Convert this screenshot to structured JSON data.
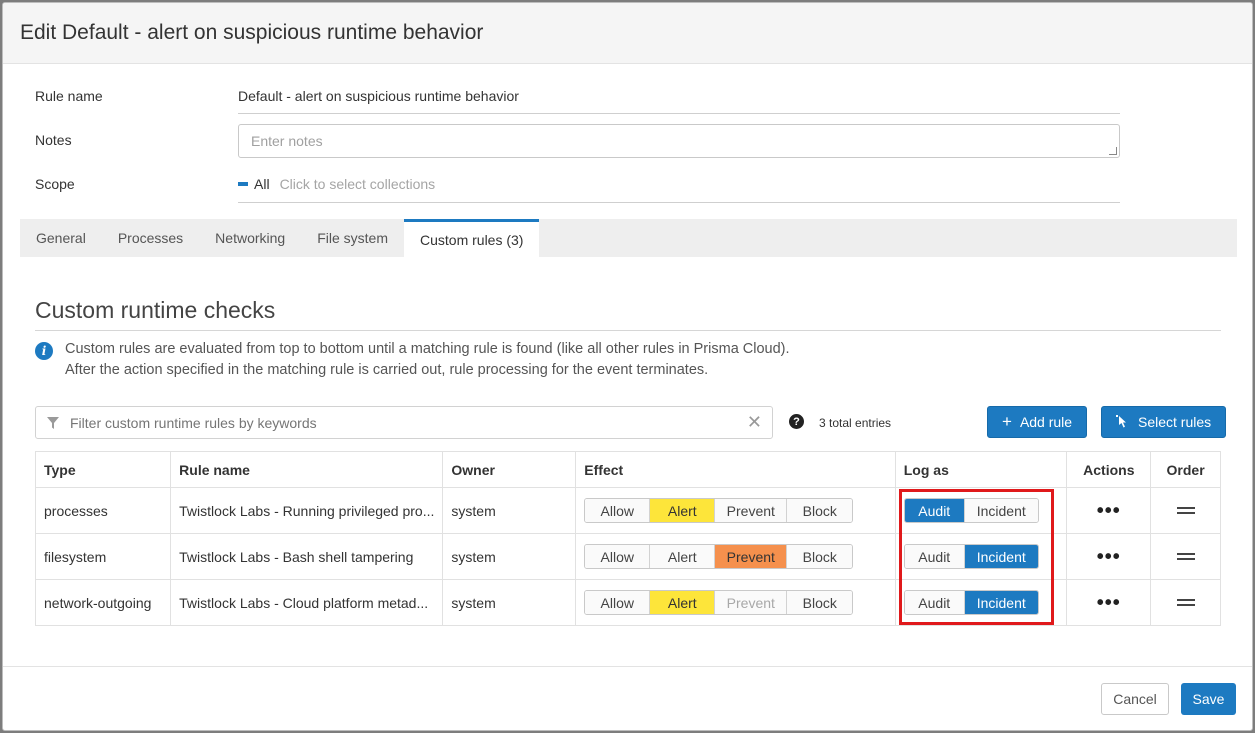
{
  "dialog": {
    "title": "Edit Default - alert on suspicious runtime behavior"
  },
  "form": {
    "rule_name_label": "Rule name",
    "rule_name_value": "Default - alert on suspicious runtime behavior",
    "notes_label": "Notes",
    "notes_placeholder": "Enter notes",
    "scope_label": "Scope",
    "scope_value": "All",
    "scope_placeholder": "Click to select collections"
  },
  "tabs": [
    {
      "label": "General"
    },
    {
      "label": "Processes"
    },
    {
      "label": "Networking"
    },
    {
      "label": "File system"
    },
    {
      "label": "Custom rules (3)"
    }
  ],
  "section": {
    "title": "Custom runtime checks",
    "info_line1": "Custom rules are evaluated from top to bottom until a matching rule is found (like all other rules in Prisma Cloud).",
    "info_line2": "After the action specified in the matching rule is carried out, rule processing for the event terminates."
  },
  "toolbar": {
    "filter_placeholder": "Filter custom runtime rules by keywords",
    "clear_symbol": "✕",
    "help_symbol": "?",
    "entries": "3 total entries",
    "add_rule": "Add rule",
    "select_rules": "Select rules"
  },
  "table": {
    "headers": {
      "type": "Type",
      "rule_name": "Rule name",
      "owner": "Owner",
      "effect": "Effect",
      "log_as": "Log as",
      "actions": "Actions",
      "order": "Order"
    },
    "effect_options": [
      "Allow",
      "Alert",
      "Prevent",
      "Block"
    ],
    "log_options": [
      "Audit",
      "Incident"
    ],
    "rows": [
      {
        "type": "processes",
        "rule_name": "Twistlock Labs - Running privileged pro...",
        "owner": "system",
        "effect": "Alert",
        "log_as": "Audit"
      },
      {
        "type": "filesystem",
        "rule_name": "Twistlock Labs - Bash shell tampering",
        "owner": "system",
        "effect": "Prevent",
        "log_as": "Incident"
      },
      {
        "type": "network-outgoing",
        "rule_name": "Twistlock Labs - Cloud platform metad...",
        "owner": "system",
        "effect": "Alert",
        "log_as": "Incident",
        "prevent_disabled": true
      }
    ],
    "actions_symbol": "•••"
  },
  "footer": {
    "cancel": "Cancel",
    "save": "Save"
  },
  "colors": {
    "primary": "#1d7ac1",
    "alert": "#fde53a",
    "prevent": "#f5904d",
    "highlight": "#e0191b"
  }
}
